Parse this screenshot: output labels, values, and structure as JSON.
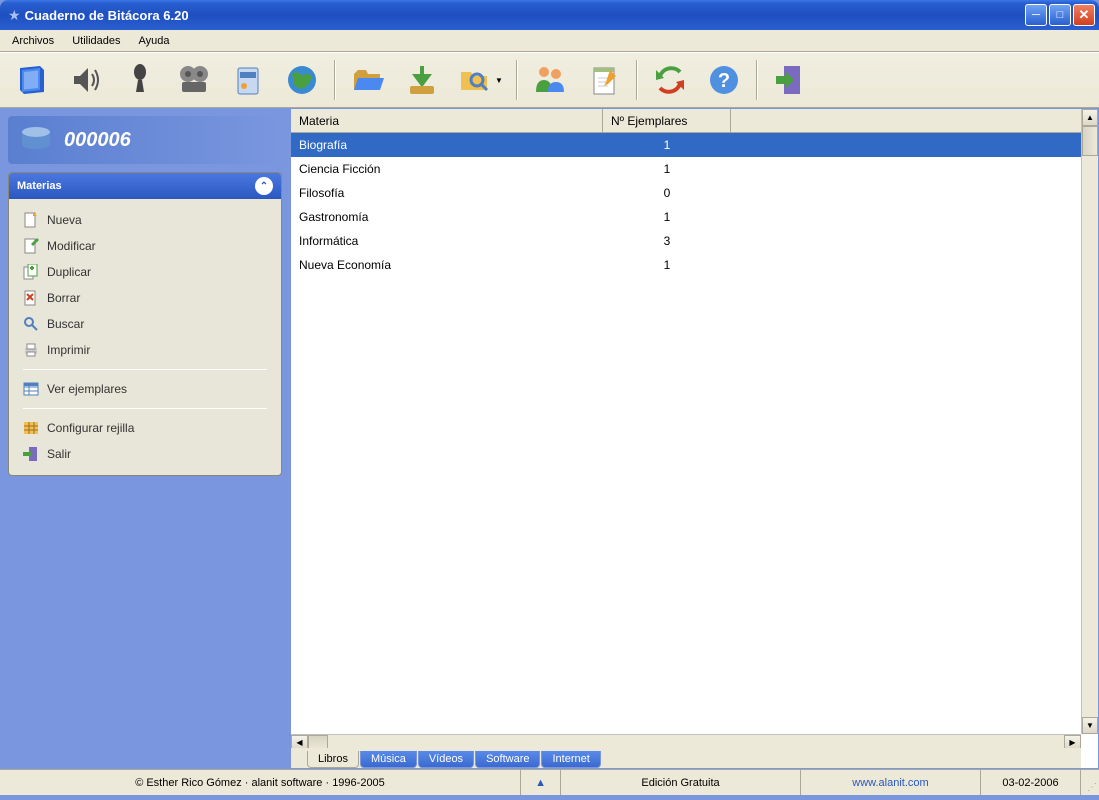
{
  "window": {
    "title": "Cuaderno de Bitácora 6.20"
  },
  "menu": {
    "items": [
      "Archivos",
      "Utilidades",
      "Ayuda"
    ]
  },
  "counter": "000006",
  "panel": {
    "title": "Materias",
    "items": [
      {
        "label": "Nueva",
        "icon": "new"
      },
      {
        "label": "Modificar",
        "icon": "edit"
      },
      {
        "label": "Duplicar",
        "icon": "duplicate"
      },
      {
        "label": "Borrar",
        "icon": "delete"
      },
      {
        "label": "Buscar",
        "icon": "search"
      },
      {
        "label": "Imprimir",
        "icon": "print"
      }
    ],
    "view_label": "Ver ejemplares",
    "config_label": "Configurar rejilla",
    "exit_label": "Salir"
  },
  "grid": {
    "columns": [
      "Materia",
      "Nº Ejemplares"
    ],
    "rows": [
      {
        "materia": "Biografía",
        "count": "1",
        "selected": true
      },
      {
        "materia": "Ciencia Ficción",
        "count": "1"
      },
      {
        "materia": "Filosofía",
        "count": "0"
      },
      {
        "materia": "Gastronomía",
        "count": "1"
      },
      {
        "materia": "Informática",
        "count": "3"
      },
      {
        "materia": "Nueva Economía",
        "count": "1"
      }
    ]
  },
  "tabs": [
    "Libros",
    "Música",
    "Vídeos",
    "Software",
    "Internet"
  ],
  "active_tab": 0,
  "status": {
    "copyright": "© Esther Rico Gómez · alanit software · 1996-2005",
    "edition": "Edición Gratuita",
    "url": "www.alanit.com",
    "date": "03-02-2006"
  }
}
